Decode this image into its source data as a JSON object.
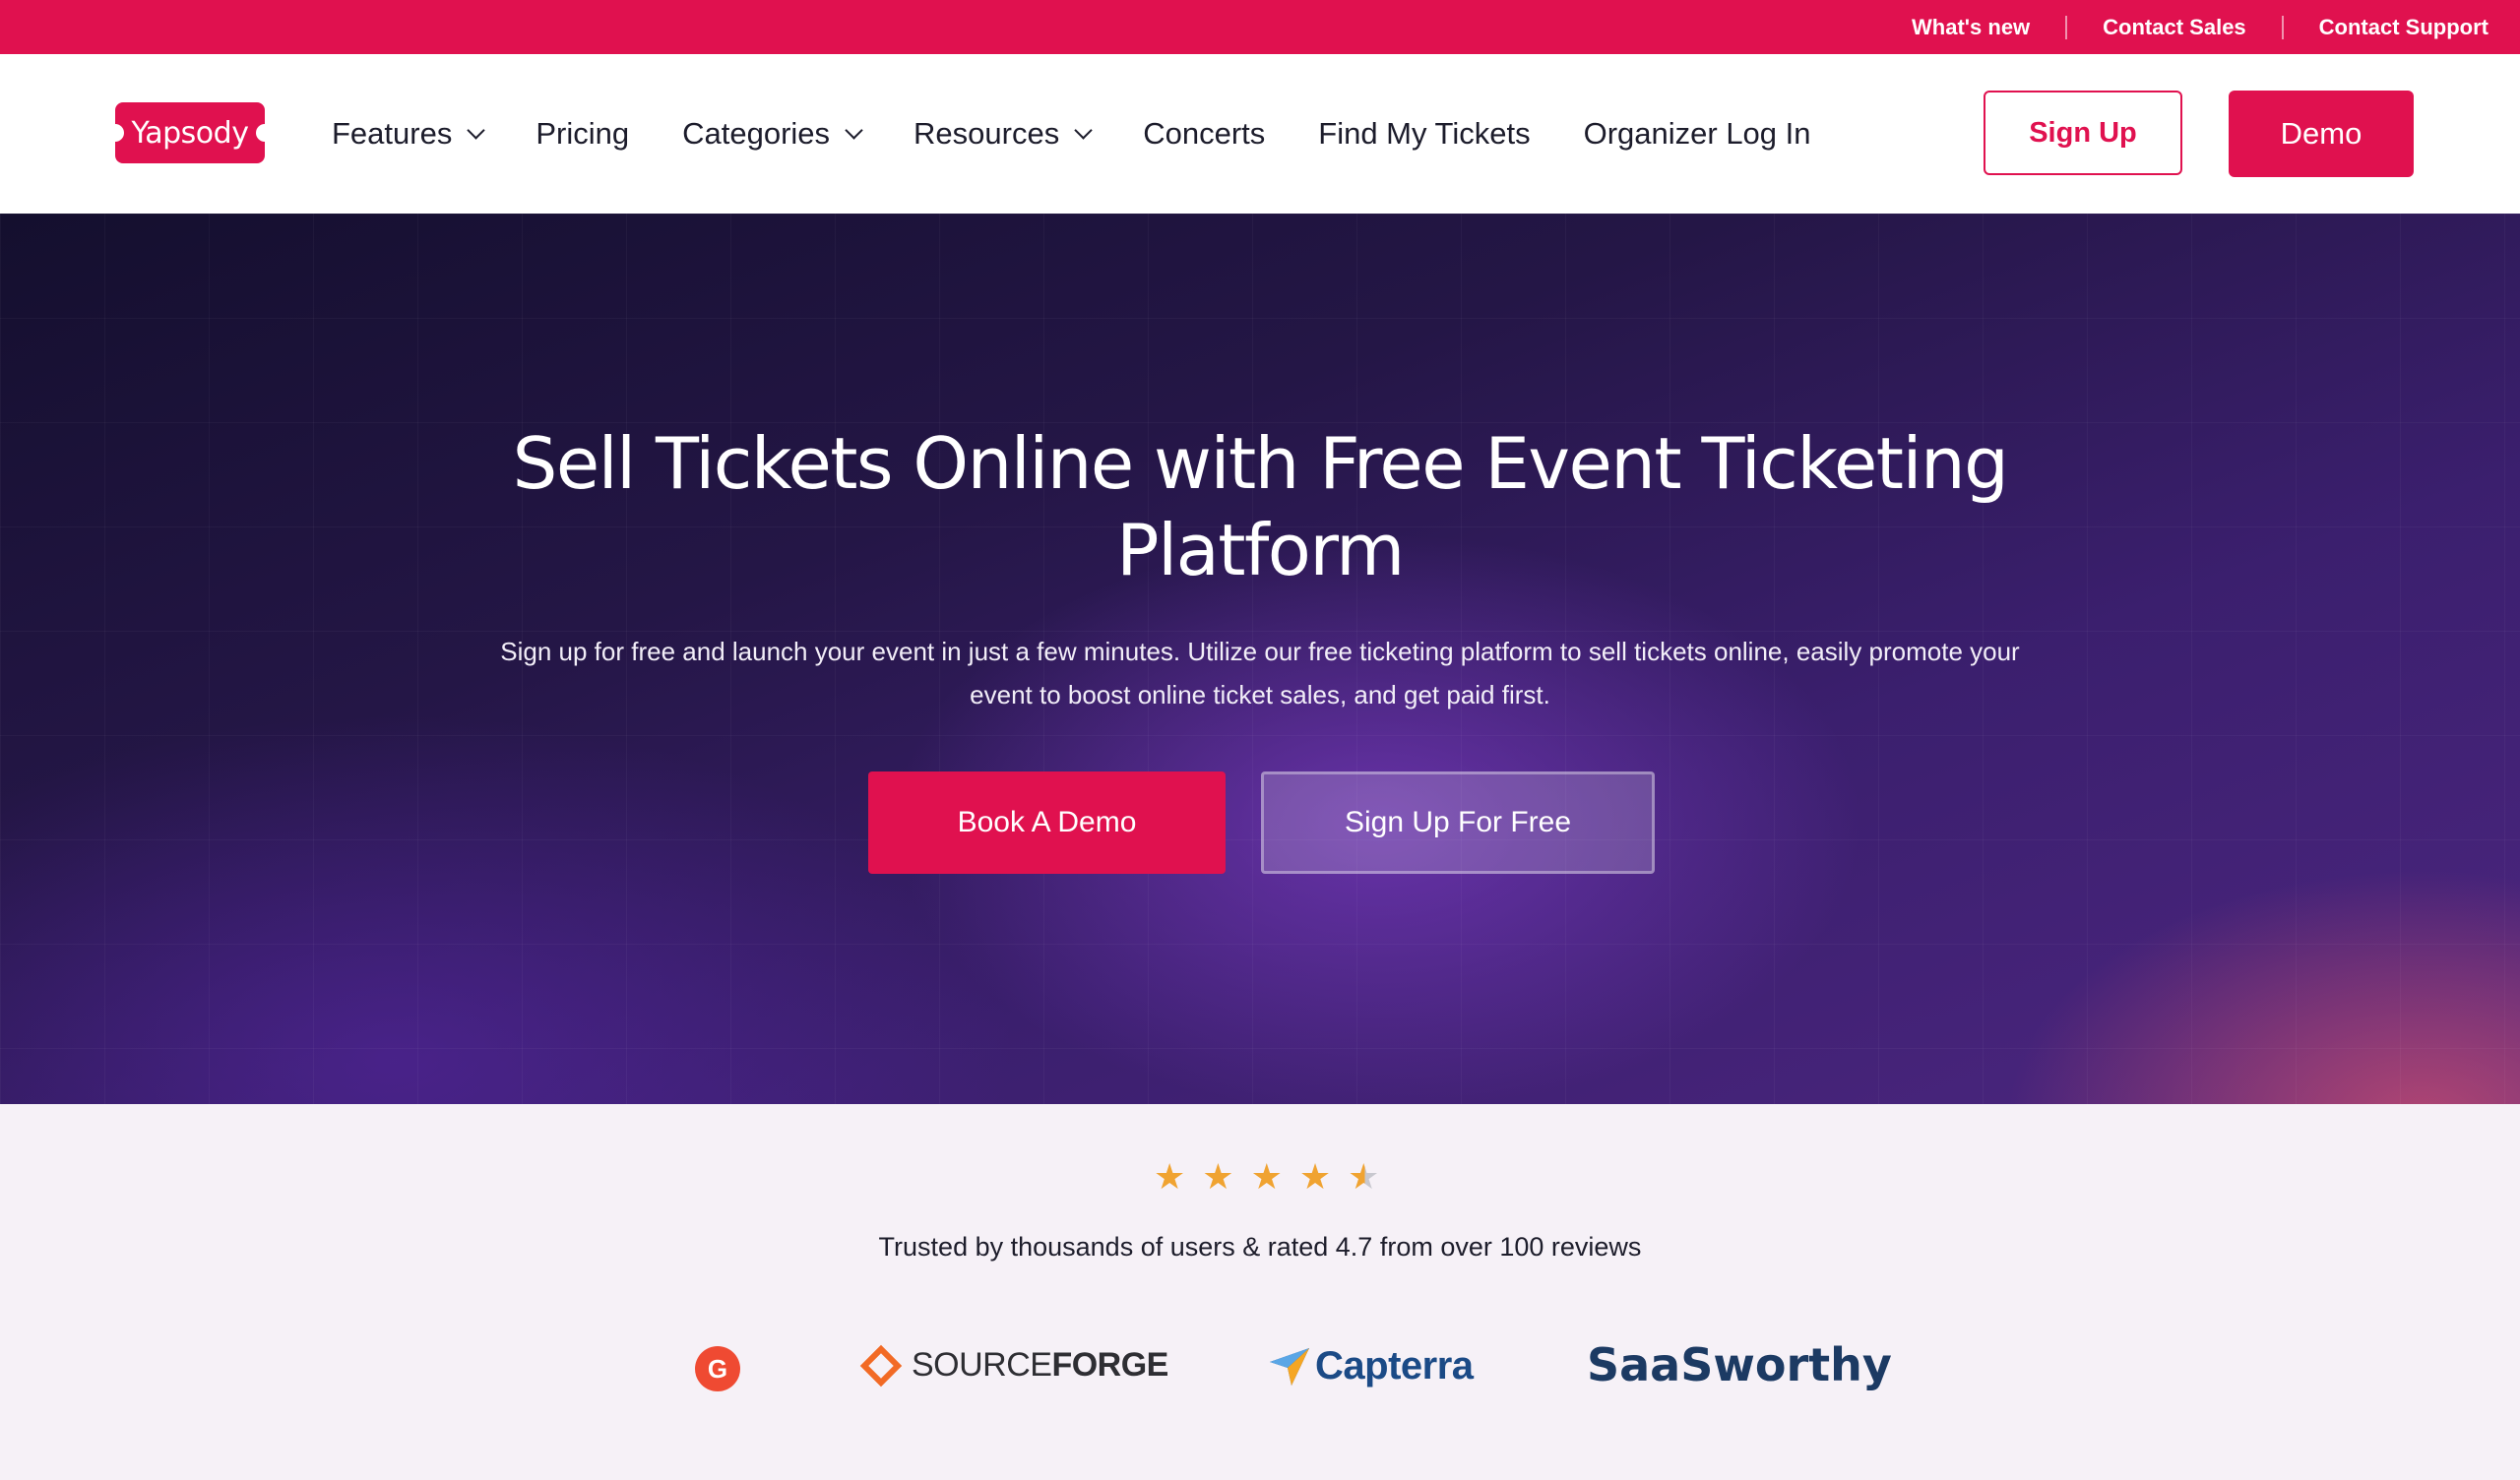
{
  "topbar": {
    "links": [
      "What's new",
      "Contact Sales",
      "Contact Support"
    ]
  },
  "navbar": {
    "logo_text": "Yapsody",
    "items": [
      {
        "label": "Features",
        "has_dropdown": true
      },
      {
        "label": "Pricing",
        "has_dropdown": false
      },
      {
        "label": "Categories",
        "has_dropdown": true
      },
      {
        "label": "Resources",
        "has_dropdown": true
      },
      {
        "label": "Concerts",
        "has_dropdown": false
      },
      {
        "label": "Find My Tickets",
        "has_dropdown": false
      },
      {
        "label": "Organizer Log In",
        "has_dropdown": false
      }
    ],
    "signup_label": "Sign Up",
    "demo_label": "Demo"
  },
  "hero": {
    "title": "Sell Tickets Online with Free Event Ticketing Platform",
    "subtitle": "Sign up for free and launch your event in just a few minutes. Utilize our free ticketing platform to sell tickets online, easily promote your event to boost online ticket sales, and get paid first.",
    "primary_button": "Book A Demo",
    "secondary_button": "Sign Up For Free"
  },
  "trust": {
    "rating": 4.7,
    "stars_shown": 5,
    "text": "Trusted by thousands of users & rated 4.7 from over 100 reviews",
    "logos": {
      "g2": "G",
      "sourceforge_light": "SOURCE",
      "sourceforge_bold": "FORGE",
      "capterra": "Capterra",
      "saasworthy": "SaaSworthy"
    }
  },
  "colors": {
    "brand": "#e0114f",
    "star": "#f0a331"
  }
}
